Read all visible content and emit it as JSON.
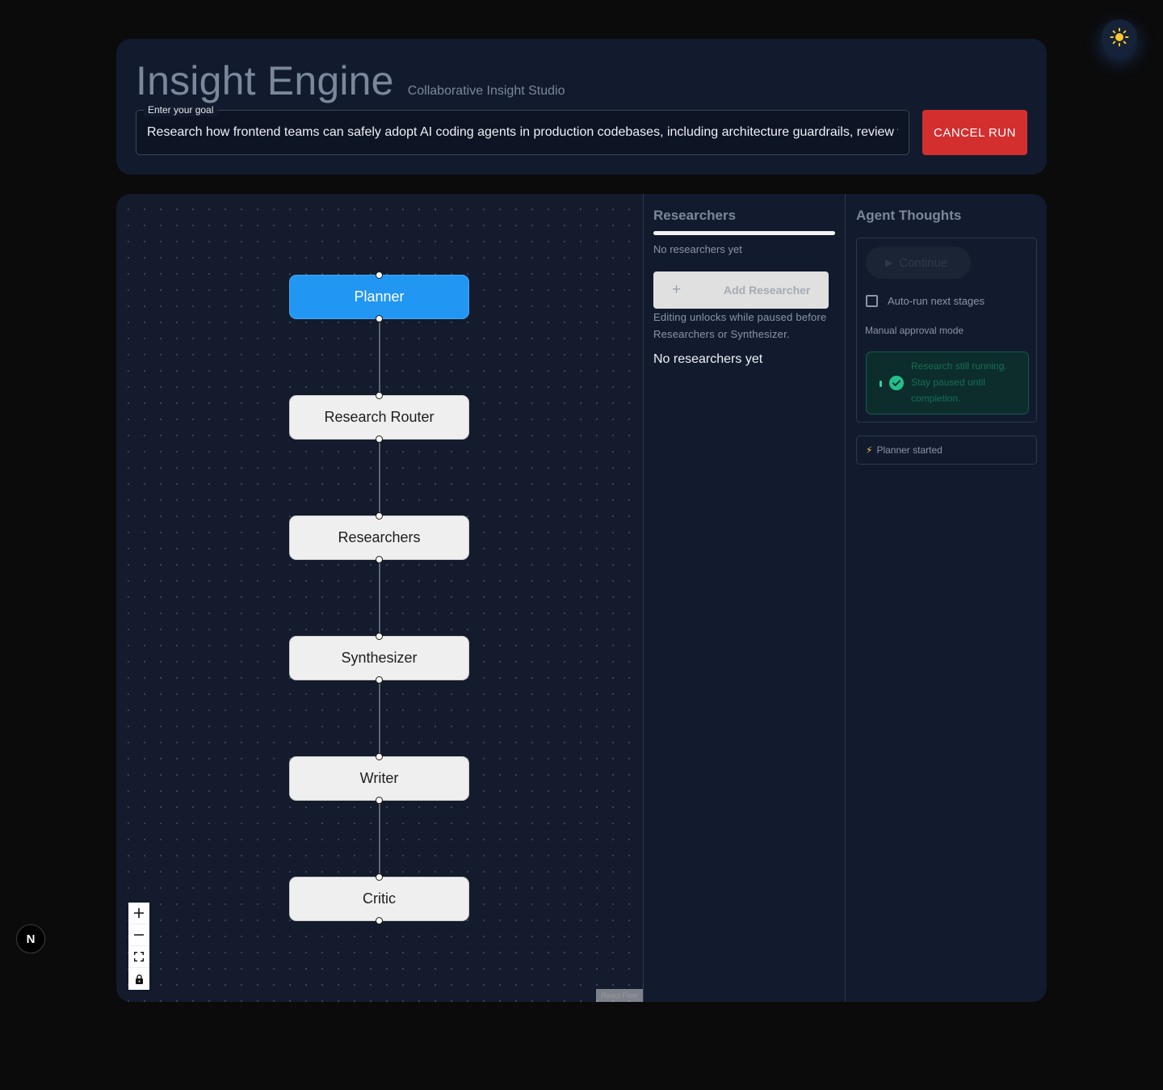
{
  "header": {
    "title": "Insight Engine",
    "subtitle": "Collaborative Insight Studio",
    "goal_label": "Enter your goal",
    "goal_value": "Research how frontend teams can safely adopt AI coding agents in production codebases, including architecture guardrails, review workflows",
    "cancel_label": "CANCEL RUN"
  },
  "flow": {
    "nodes": [
      {
        "label": "Planner",
        "state": "active"
      },
      {
        "label": "Research Router",
        "state": "idle"
      },
      {
        "label": "Researchers",
        "state": "idle"
      },
      {
        "label": "Synthesizer",
        "state": "idle"
      },
      {
        "label": "Writer",
        "state": "idle"
      },
      {
        "label": "Critic",
        "state": "idle"
      }
    ],
    "controls": [
      "zoom-in",
      "zoom-out",
      "fit-view",
      "lock"
    ],
    "attribution": "React Flow"
  },
  "researchers": {
    "title": "Researchers",
    "progress": 1.0,
    "status_text": "No researchers yet",
    "add_label": "Add Researcher",
    "hint": "Editing unlocks while paused before Researchers or Synthesizer.",
    "empty_text": "No researchers yet"
  },
  "thoughts": {
    "title": "Agent Thoughts",
    "continue_label": "Continue",
    "auto_run_label": "Auto-run next stages",
    "auto_run_checked": false,
    "mode_text": "Manual approval mode",
    "status_message": "Research still running. Stay paused until completion.",
    "items": [
      {
        "icon": "lightning-icon",
        "text": "Planner started"
      }
    ]
  },
  "colors": {
    "accent": "#2196f3",
    "danger": "#d32f2f",
    "success": "#2fd0a0"
  },
  "badge": {
    "label": "N"
  }
}
